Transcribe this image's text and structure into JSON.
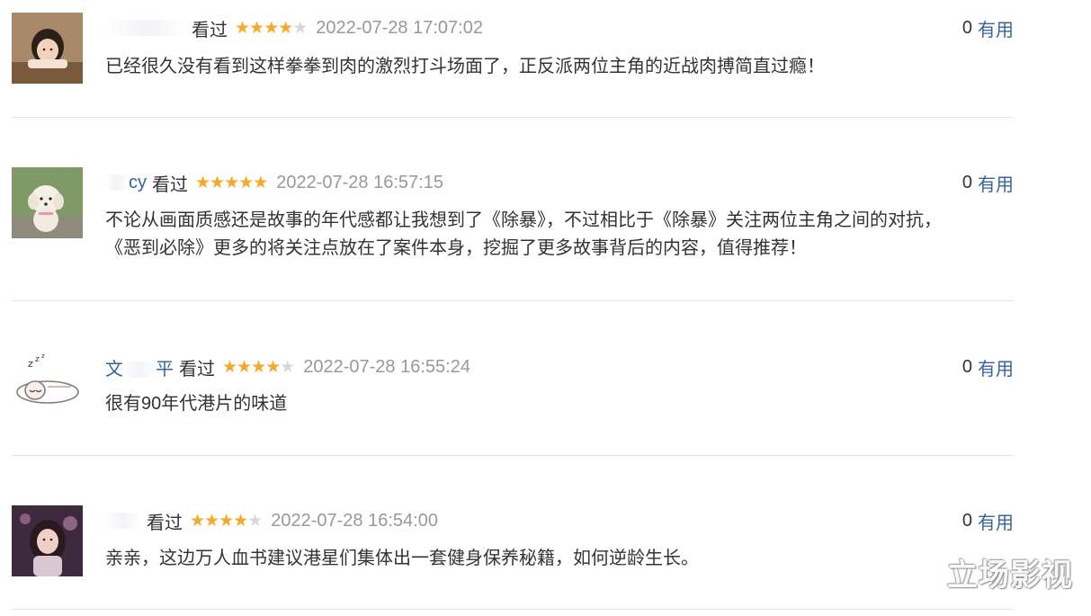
{
  "reviews": [
    {
      "username_visible": "",
      "watched": "看过",
      "rating": 4,
      "time": "2022-07-28 17:07:02",
      "useful_count": "0",
      "useful_label": "有用",
      "content": "已经很久没有看到这样拳拳到肉的激烈打斗场面了，正反派两位主角的近战肉搏简直过瘾！",
      "avatar": "avatar-child-photo"
    },
    {
      "username_visible": "cy",
      "watched": "看过",
      "rating": 5,
      "time": "2022-07-28 16:57:15",
      "useful_count": "0",
      "useful_label": "有用",
      "content_lines": [
        "不论从画面质感还是故事的年代感都让我想到了《除暴》，不过相比于《除暴》关注两位主角之间的对抗，",
        "《恶到必除》更多的将关注点放在了案件本身，挖掘了更多故事背后的内容，值得推荐！"
      ],
      "avatar": "avatar-dog-photo"
    },
    {
      "username_visible_start": "文",
      "username_visible_end": "平",
      "watched": "看过",
      "rating": 4,
      "time": "2022-07-28 16:55:24",
      "useful_count": "0",
      "useful_label": "有用",
      "content": "很有90年代港片的味道",
      "avatar": "avatar-sleeping-cartoon"
    },
    {
      "username_visible": "",
      "watched": "看过",
      "rating": 4,
      "time": "2022-07-28 16:54:00",
      "useful_count": "0",
      "useful_label": "有用",
      "content": "亲亲，这边万人血书建议港星们集体出一套健身保养秘籍，如何逆龄生长。",
      "avatar": "avatar-girl-photo"
    }
  ],
  "watermark": "立场影视",
  "colors": {
    "star_on": "#f4a928",
    "star_off": "#d8d8d8",
    "link": "#37649e",
    "time": "#999999",
    "divider": "#e4e4e4"
  }
}
